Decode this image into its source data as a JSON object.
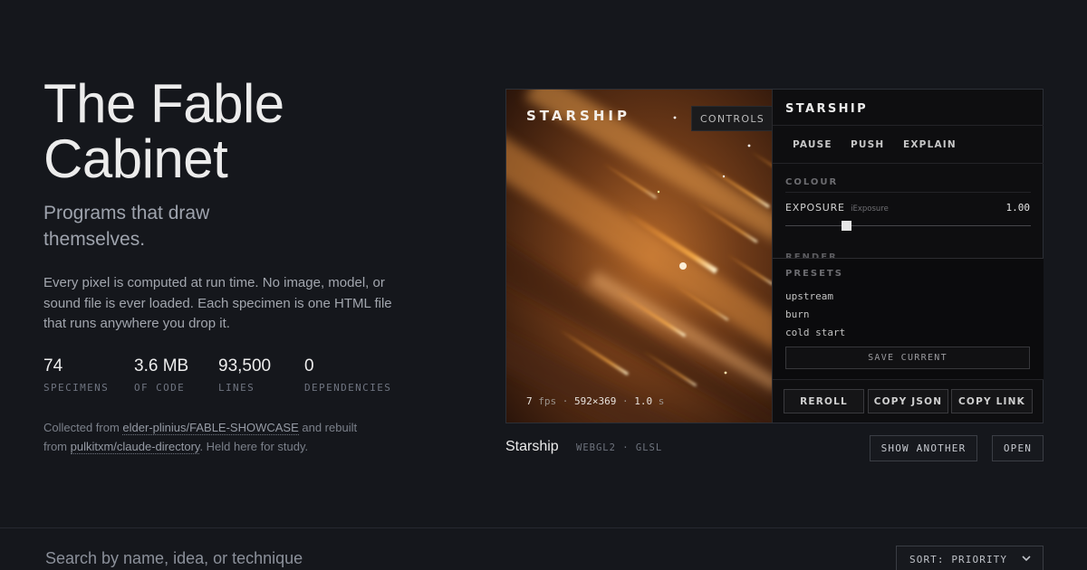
{
  "hero": {
    "title_line1": "The Fable",
    "title_line2": "Cabinet",
    "subtitle": "Programs that draw themselves.",
    "description": "Every pixel is computed at run time. No image, model, or sound file is ever loaded. Each specimen is one HTML file that runs anywhere you drop it.",
    "stats": [
      {
        "value": "74",
        "label": "SPECIMENS"
      },
      {
        "value": "3.6 MB",
        "label": "OF CODE"
      },
      {
        "value": "93,500",
        "label": "LINES"
      },
      {
        "value": "0",
        "label": "DEPENDENCIES"
      }
    ],
    "credits": {
      "prefix": "Collected from ",
      "source_link": "elder-plinius/FABLE-SHOWCASE",
      "middle": " and rebuilt from ",
      "rebuild_link": "pulkitxm/claude-directory",
      "suffix": ". Held here for study."
    }
  },
  "viewer": {
    "canvas_title": "STARSHIP",
    "controls_tab": "CONTROLS",
    "fps": "7",
    "fps_unit": "fps",
    "resolution": "592×369",
    "time": "1.0",
    "time_unit": "s",
    "separator": "·",
    "panel": {
      "title": "STARSHIP",
      "actions": [
        "PAUSE",
        "PUSH",
        "EXPLAIN"
      ],
      "colour_heading": "COLOUR",
      "exposure_label": "EXPOSURE",
      "exposure_uniform": "iExposure",
      "exposure_value": "1.00",
      "exposure_level": 0.25,
      "render_heading": "RENDER",
      "presets_heading": "PRESETS",
      "presets": [
        "upstream",
        "burn",
        "cold start"
      ],
      "save_label": "SAVE CURRENT",
      "buttons": [
        "REROLL",
        "COPY JSON",
        "COPY LINK"
      ]
    }
  },
  "caption": {
    "name": "Starship",
    "tags": "WEBGL2 · GLSL",
    "show_another": "SHOW ANOTHER",
    "open": "OPEN"
  },
  "search": {
    "placeholder": "Search by name, idea, or technique",
    "sort_label": "SORT: PRIORITY"
  },
  "colors": {
    "background": "#15171c",
    "accent_fire": "#ff9a2e",
    "text_primary": "#ececec"
  }
}
